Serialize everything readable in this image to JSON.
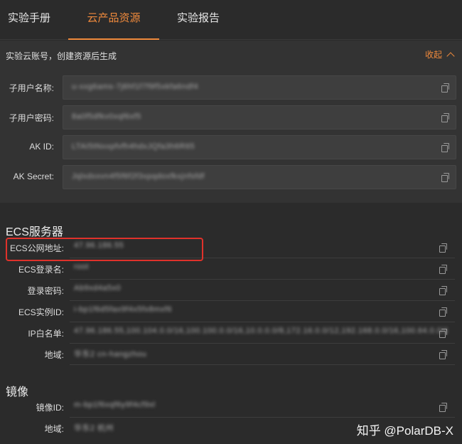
{
  "tabs": [
    {
      "label": "实验手册",
      "active": false
    },
    {
      "label": "云产品资源",
      "active": true
    },
    {
      "label": "实验报告",
      "active": false
    }
  ],
  "account": {
    "header": "实验云账号，创建资源后生成",
    "collapse_label": "收起",
    "fields": [
      {
        "label": "子用户名称:",
        "value": "u-xxg6ams-7j6hf1f7f9f5xkfa6ndf4"
      },
      {
        "label": "子用户密码:",
        "value": "8a0f5dfkv0xqf6xf5"
      },
      {
        "label": "AK ID:",
        "value": "LTAI5tNxxpfvfh4hdxJQfa3h6R65"
      },
      {
        "label": "AK Secret:",
        "value": "Jqlxdxxvn4f5f6f2f3xpqdoxfkxjnfsfdf"
      }
    ]
  },
  "ecs": {
    "title": "ECS服务器",
    "fields": [
      {
        "label": "ECS公网地址:",
        "value": "47.96.186.55"
      },
      {
        "label": "ECS登录名:",
        "value": "root"
      },
      {
        "label": "登录密码:",
        "value": "Ab9xd4a5x0"
      },
      {
        "label": "ECS实例ID:",
        "value": "i-bp1f6d5fax9f4x5fx8mxf6"
      },
      {
        "label": "IP白名单:",
        "value": "47.96.186.55,100.104.0.0/16,100.100.0.0/16,10.0.0.0/8,172.16.0.0/12,192.168.0.0/16,100.64.0.0/10"
      },
      {
        "label": "地域:",
        "value": "华东2 cn-hangzhou"
      }
    ]
  },
  "image": {
    "title": "镜像",
    "fields": [
      {
        "label": "镜像ID:",
        "value": "m-bp1f6xqf6y9f4cf9xl"
      },
      {
        "label": "地域:",
        "value": "华东2 杭州"
      }
    ]
  },
  "watermark": "知乎 @PolarDB-X",
  "colors": {
    "accent": "#f08a3c",
    "highlight": "#e0322b"
  }
}
